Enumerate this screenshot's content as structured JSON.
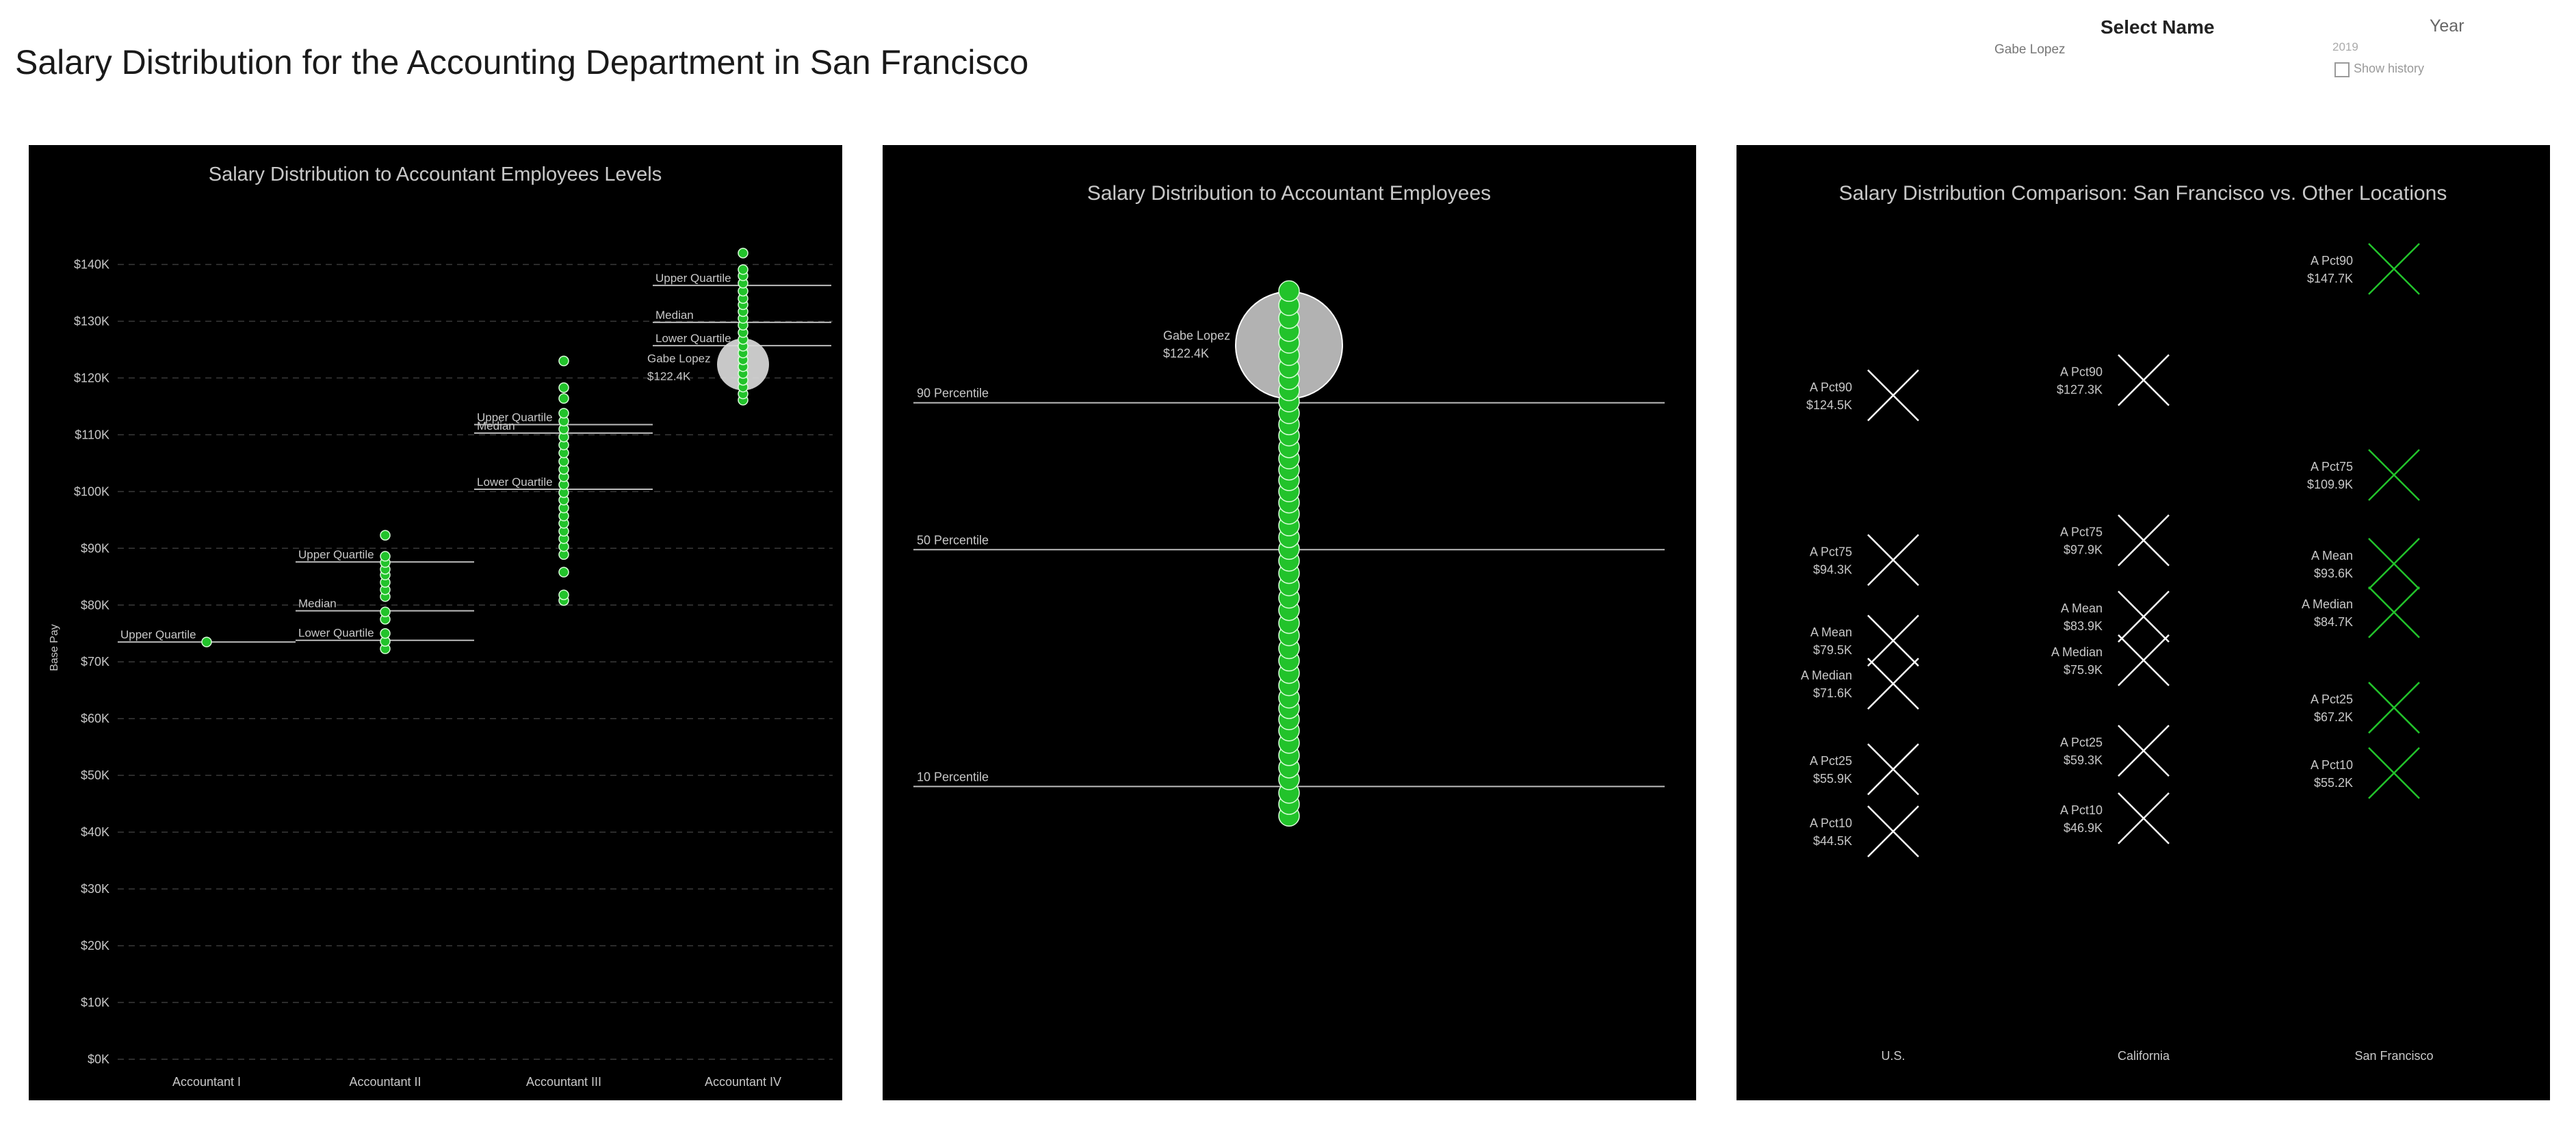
{
  "dashboard": {
    "title": "Salary Distribution for the Accounting Department in San Francisco"
  },
  "filters": {
    "select_name_label": "Select Name",
    "selected_name": "Gabe Lopez",
    "year_label": "Year",
    "year_value": "2019",
    "show_history_label": "Show history",
    "show_history_checked": false
  },
  "colors": {
    "accent": "#22c32b",
    "highlight": "#d9d9d9",
    "background": "#000000",
    "text": "#c8c8c8"
  },
  "chart_data": [
    {
      "type": "scatter",
      "title": "Salary Distribution to Accountant Employees Levels",
      "xlabel": "",
      "ylabel": "Base Pay",
      "ylim": [
        0,
        145000
      ],
      "yticks": [
        0,
        10000,
        20000,
        30000,
        40000,
        50000,
        60000,
        70000,
        80000,
        90000,
        100000,
        110000,
        120000,
        130000,
        140000
      ],
      "ytick_labels": [
        "$0K",
        "$10K",
        "$20K",
        "$30K",
        "$40K",
        "$50K",
        "$60K",
        "$70K",
        "$80K",
        "$90K",
        "$100K",
        "$110K",
        "$120K",
        "$130K",
        "$140K"
      ],
      "grid": true,
      "categories": [
        "Accountant I",
        "Accountant II",
        "Accountant III",
        "Accountant IV"
      ],
      "points": [
        {
          "category": "Accountant I",
          "values": [
            73500
          ]
        },
        {
          "category": "Accountant II",
          "values": [
            72300,
            73600,
            75000,
            77500,
            78800,
            81500,
            82700,
            84000,
            85300,
            86300,
            87500,
            88600,
            92300
          ]
        },
        {
          "category": "Accountant III",
          "values": [
            80800,
            81800,
            85800,
            88900,
            90300,
            91700,
            93000,
            94400,
            95700,
            97100,
            98500,
            99800,
            101200,
            102600,
            103900,
            105300,
            106800,
            108200,
            109600,
            111000,
            112400,
            113800,
            116400,
            118300,
            123000
          ]
        },
        {
          "category": "Accountant IV",
          "values": [
            116100,
            117200,
            118400,
            119600,
            120800,
            122000,
            123200,
            124400,
            125600,
            126800,
            128000,
            129300,
            130500,
            131700,
            132900,
            134000,
            135300,
            136700,
            138000,
            139100,
            142000
          ]
        }
      ],
      "reference_lines": [
        {
          "category": "Accountant I",
          "label": "Upper Quartile",
          "value": 73500
        },
        {
          "category": "Accountant II",
          "label": "Upper Quartile",
          "value": 87600
        },
        {
          "category": "Accountant II",
          "label": "Median",
          "value": 79000
        },
        {
          "category": "Accountant II",
          "label": "Lower Quartile",
          "value": 73800
        },
        {
          "category": "Accountant III",
          "label": "Upper Quartile",
          "value": 111800
        },
        {
          "category": "Accountant III",
          "label": "Median",
          "value": 110300
        },
        {
          "category": "Accountant III",
          "label": "Lower Quartile",
          "value": 100400
        },
        {
          "category": "Accountant IV",
          "label": "Upper Quartile",
          "value": 136300
        },
        {
          "category": "Accountant IV",
          "label": "Median",
          "value": 129800
        },
        {
          "category": "Accountant IV",
          "label": "Lower Quartile",
          "value": 125700
        }
      ],
      "highlight": {
        "name": "Gabe Lopez",
        "value": 122400,
        "value_label": "$122.4K",
        "category": "Accountant IV"
      }
    },
    {
      "type": "scatter",
      "title": "Salary Distribution to Accountant Employees",
      "ylim": [
        40000,
        132000
      ],
      "values": [
        42300,
        44300,
        46200,
        48500,
        50500,
        52600,
        54700,
        56800,
        58700,
        60600,
        62400,
        64500,
        66600,
        68700,
        70800,
        73000,
        75100,
        77300,
        79400,
        81500,
        83600,
        85700,
        87700,
        89700,
        91700,
        93700,
        95600,
        97500,
        99400,
        101200,
        103100,
        105000,
        107000,
        108900,
        110800,
        112800,
        114700,
        116600,
        118600,
        120700,
        122800,
        124800,
        127000,
        129200,
        131600
      ],
      "reference_lines": [
        {
          "label": "90 Percentile",
          "value": 112600
        },
        {
          "label": "50 Percentile",
          "value": 87600
        },
        {
          "label": "10 Percentile",
          "value": 47300
        }
      ],
      "highlight": {
        "name": "Gabe Lopez",
        "value": 122400,
        "value_label": "$122.4K"
      }
    },
    {
      "type": "scatter",
      "title": "Salary Distribution  Comparison: San Francisco vs. Other Locations",
      "categories": [
        "U.S.",
        "California",
        "San Francisco"
      ],
      "ylim": [
        0,
        160000
      ],
      "series": [
        {
          "location": "U.S.",
          "points": [
            {
              "label": "A Pct90",
              "value": 124500,
              "value_label": "$124.5K"
            },
            {
              "label": "A Pct75",
              "value": 94300,
              "value_label": "$94.3K"
            },
            {
              "label": "A Mean",
              "value": 79500,
              "value_label": "$79.5K"
            },
            {
              "label": "A Median",
              "value": 71600,
              "value_label": "$71.6K"
            },
            {
              "label": "A Pct25",
              "value": 55900,
              "value_label": "$55.9K"
            },
            {
              "label": "A Pct10",
              "value": 44500,
              "value_label": "$44.5K"
            }
          ]
        },
        {
          "location": "California",
          "points": [
            {
              "label": "A Pct90",
              "value": 127300,
              "value_label": "$127.3K"
            },
            {
              "label": "A Pct75",
              "value": 97900,
              "value_label": "$97.9K"
            },
            {
              "label": "A Mean",
              "value": 83900,
              "value_label": "$83.9K"
            },
            {
              "label": "A Median",
              "value": 75900,
              "value_label": "$75.9K"
            },
            {
              "label": "A Pct25",
              "value": 59300,
              "value_label": "$59.3K"
            },
            {
              "label": "A Pct10",
              "value": 46900,
              "value_label": "$46.9K"
            }
          ]
        },
        {
          "location": "San Francisco",
          "points": [
            {
              "label": "A Pct90",
              "value": 147700,
              "value_label": "$147.7K"
            },
            {
              "label": "A Pct75",
              "value": 109900,
              "value_label": "$109.9K"
            },
            {
              "label": "A Mean",
              "value": 93600,
              "value_label": "$93.6K"
            },
            {
              "label": "A Median",
              "value": 84700,
              "value_label": "$84.7K"
            },
            {
              "label": "A Pct25",
              "value": 67200,
              "value_label": "$67.2K"
            },
            {
              "label": "A Pct10",
              "value": 55200,
              "value_label": "$55.2K"
            }
          ]
        }
      ]
    }
  ]
}
